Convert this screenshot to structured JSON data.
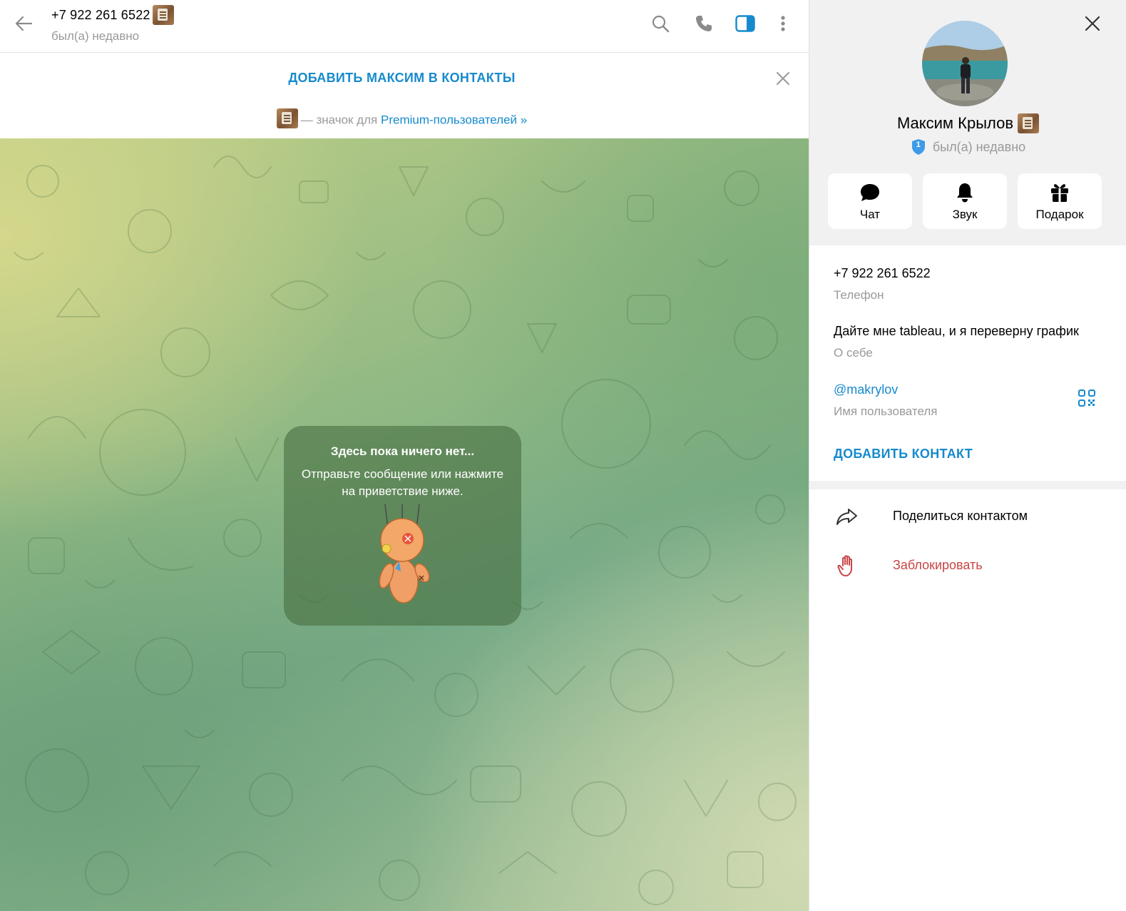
{
  "chat_header": {
    "peer_name": "+7 922 261 6522",
    "peer_status": "был(а) недавно",
    "icons": [
      "back-arrow-icon",
      "search-icon",
      "phone-icon",
      "sidebar-toggle-icon",
      "more-vertical-icon"
    ]
  },
  "add_contact_bar": {
    "link_label": "ДОБАВИТЬ МАКСИМ В КОНТАКТЫ",
    "premium_note_prefix": "— значок для ",
    "premium_note_link": "Premium-пользователей »"
  },
  "empty_chat": {
    "title": "Здесь пока ничего нет...",
    "text": "Отправьте сообщение или нажмите на приветствие ниже.",
    "sticker": "voodoo-doll-sticker"
  },
  "profile": {
    "name": "Максим Крылов",
    "level": "1",
    "status": "был(а) недавно",
    "actions": [
      {
        "label": "Чат",
        "icon": "chat-bubble-icon"
      },
      {
        "label": "Звук",
        "icon": "bell-icon"
      },
      {
        "label": "Подарок",
        "icon": "gift-icon"
      }
    ],
    "phone": "+7 922 261 6522",
    "phone_label": "Телефон",
    "bio": "Дайте мне tableau, и я переверну график",
    "bio_label": "О себе",
    "username": "@makrylov",
    "username_label": "Имя пользователя",
    "add_contact_label": "ДОБАВИТЬ КОНТАКТ",
    "share_label": "Поделиться контактом",
    "block_label": "Заблокировать"
  },
  "colors": {
    "accent": "#168acd",
    "danger": "#c94545",
    "secondary_text": "#999999",
    "panel_gray": "#f1f1f1"
  }
}
